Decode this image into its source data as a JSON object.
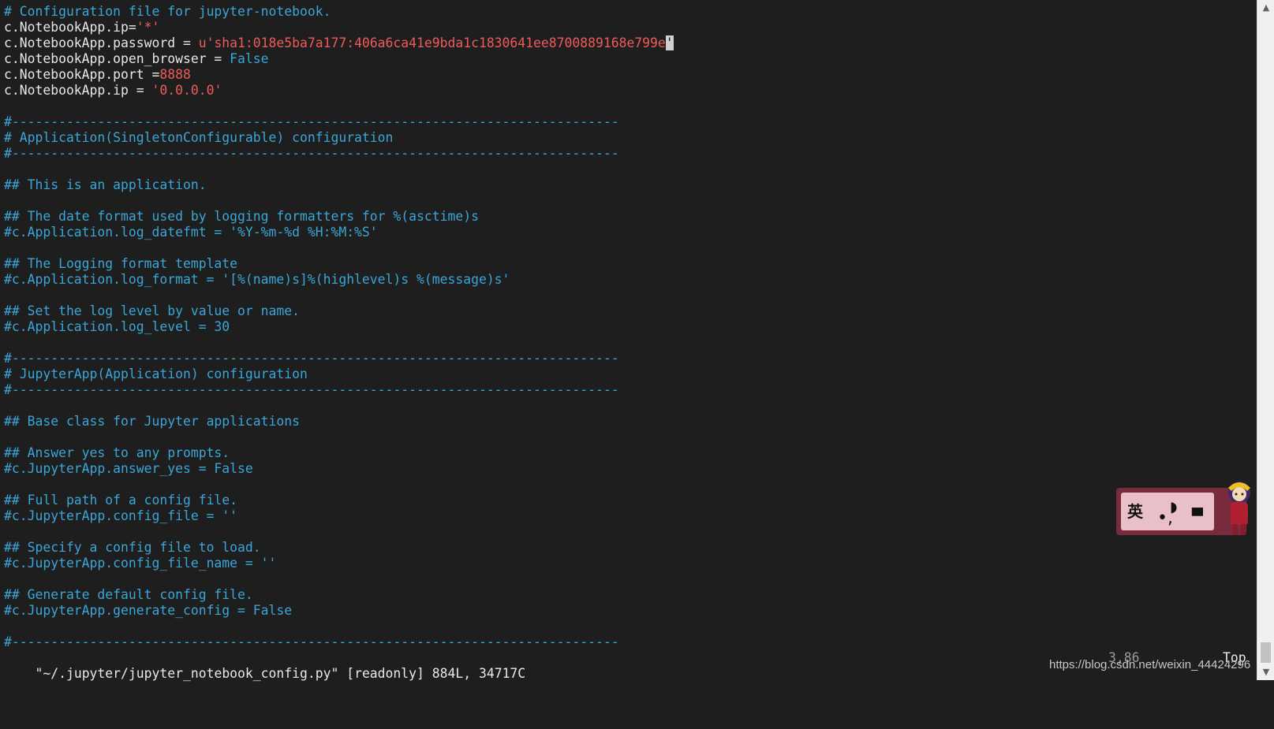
{
  "editor": {
    "lines": [
      [
        {
          "t": "# Configuration file for jupyter-notebook.",
          "c": "comment"
        }
      ],
      [
        {
          "t": "c.NotebookApp.ip=",
          "c": "text"
        },
        {
          "t": "'*'",
          "c": "str"
        }
      ],
      [
        {
          "t": "c.NotebookApp.password = ",
          "c": "text"
        },
        {
          "t": "u'sha1:018e5ba7a177:406a6ca41e9bda1c1830641ee8700889168e799e",
          "c": "str"
        },
        {
          "t": "'",
          "c": "cursor"
        }
      ],
      [
        {
          "t": "c.NotebookApp.open_browser = ",
          "c": "text"
        },
        {
          "t": "False",
          "c": "const"
        }
      ],
      [
        {
          "t": "c.NotebookApp.port =",
          "c": "text"
        },
        {
          "t": "8888",
          "c": "num"
        }
      ],
      [
        {
          "t": "c.NotebookApp.ip = ",
          "c": "text"
        },
        {
          "t": "'0.0.0.0'",
          "c": "str"
        }
      ],
      [],
      [
        {
          "t": "#------------------------------------------------------------------------------",
          "c": "comment"
        }
      ],
      [
        {
          "t": "# Application(SingletonConfigurable) configuration",
          "c": "comment"
        }
      ],
      [
        {
          "t": "#------------------------------------------------------------------------------",
          "c": "comment"
        }
      ],
      [],
      [
        {
          "t": "## This is an application.",
          "c": "comment"
        }
      ],
      [],
      [
        {
          "t": "## The date format used by logging formatters for %(asctime)s",
          "c": "comment"
        }
      ],
      [
        {
          "t": "#c.Application.log_datefmt = '%Y-%m-%d %H:%M:%S'",
          "c": "comment"
        }
      ],
      [],
      [
        {
          "t": "## The Logging format template",
          "c": "comment"
        }
      ],
      [
        {
          "t": "#c.Application.log_format = '[%(name)s]%(highlevel)s %(message)s'",
          "c": "comment"
        }
      ],
      [],
      [
        {
          "t": "## Set the log level by value or name.",
          "c": "comment"
        }
      ],
      [
        {
          "t": "#c.Application.log_level = 30",
          "c": "comment"
        }
      ],
      [],
      [
        {
          "t": "#------------------------------------------------------------------------------",
          "c": "comment"
        }
      ],
      [
        {
          "t": "# JupyterApp(Application) configuration",
          "c": "comment"
        }
      ],
      [
        {
          "t": "#------------------------------------------------------------------------------",
          "c": "comment"
        }
      ],
      [],
      [
        {
          "t": "## Base class for Jupyter applications",
          "c": "comment"
        }
      ],
      [],
      [
        {
          "t": "## Answer yes to any prompts.",
          "c": "comment"
        }
      ],
      [
        {
          "t": "#c.JupyterApp.answer_yes = False",
          "c": "comment"
        }
      ],
      [],
      [
        {
          "t": "## Full path of a config file.",
          "c": "comment"
        }
      ],
      [
        {
          "t": "#c.JupyterApp.config_file = ''",
          "c": "comment"
        }
      ],
      [],
      [
        {
          "t": "## Specify a config file to load.",
          "c": "comment"
        }
      ],
      [
        {
          "t": "#c.JupyterApp.config_file_name = ''",
          "c": "comment"
        }
      ],
      [],
      [
        {
          "t": "## Generate default config file.",
          "c": "comment"
        }
      ],
      [
        {
          "t": "#c.JupyterApp.generate_config = False",
          "c": "comment"
        }
      ],
      [],
      [
        {
          "t": "#------------------------------------------------------------------------------",
          "c": "comment"
        }
      ]
    ]
  },
  "status": {
    "file_info": "\"~/.jupyter/jupyter_notebook_config.py\" [readonly] 884L, 34717C",
    "cursor_pos": "3,86",
    "scroll_pos": "Top"
  },
  "watermark": "https://blog.csdn.net/weixin_44424296",
  "ime": {
    "lang_char": "英",
    "punct_char": "•,",
    "moon_glyph": "◗",
    "skin_glyph": "▀"
  },
  "scrollbar": {
    "up_glyph": "▲",
    "down_glyph": "▼"
  },
  "colors": {
    "background": "#1e1e1e",
    "comment": "#3aa6d8",
    "string": "#f05a5a",
    "text": "#e8e8e8"
  }
}
